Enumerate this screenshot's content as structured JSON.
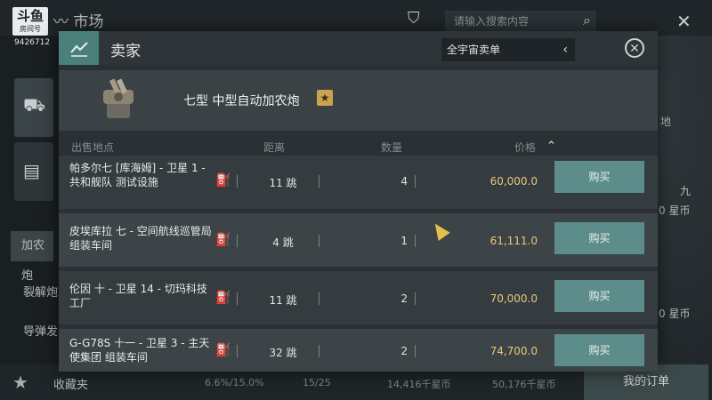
{
  "background": {
    "logo_text": "斗鱼",
    "logo_sub": "房间号",
    "room_id": "9426712",
    "window_title": "市场",
    "search_placeholder": "请输入搜索内容",
    "left_labels": [
      "加农炮",
      "裂解炮",
      "导弹发"
    ],
    "right_fragments": [
      "地",
      "九",
      "0 星币",
      "0 星币"
    ],
    "favorites_label": "收藏夹",
    "stats": [
      "6.6%/15.0%",
      "15/25",
      "14,416千星币",
      "50,176千星币"
    ],
    "my_orders_label": "我的订单"
  },
  "modal": {
    "title": "卖家",
    "region_select": "全宇宙卖单",
    "item_name": "七型 中型自动加农炮",
    "star_badge": "★",
    "columns": {
      "location": "出售地点",
      "distance": "距离",
      "quantity": "数量",
      "price": "价格"
    },
    "orders": [
      {
        "location": "帕多尔七 [库海姆] - 卫星 1 - 共和舰队 测试设施",
        "distance": "11 跳",
        "quantity": "4",
        "price": "60,000.0",
        "buy": "购买"
      },
      {
        "location": "皮埃库拉 七 - 空间航线巡管局 组装车间",
        "distance": "4 跳",
        "quantity": "1",
        "price": "61,111.0",
        "buy": "购买"
      },
      {
        "location": "伦因 十 - 卫星 14 - 切玛科技 工厂",
        "distance": "11 跳",
        "quantity": "2",
        "price": "70,000.0",
        "buy": "购买"
      },
      {
        "location": "G-G78S 十一 - 卫星 3 - 主天使集团 组装车间",
        "distance": "32 跳",
        "quantity": "2",
        "price": "74,700.0",
        "buy": "购买"
      }
    ]
  },
  "colors": {
    "accent": "#5d8d8a",
    "price": "#e8c77a",
    "star": "#c9a34e"
  }
}
